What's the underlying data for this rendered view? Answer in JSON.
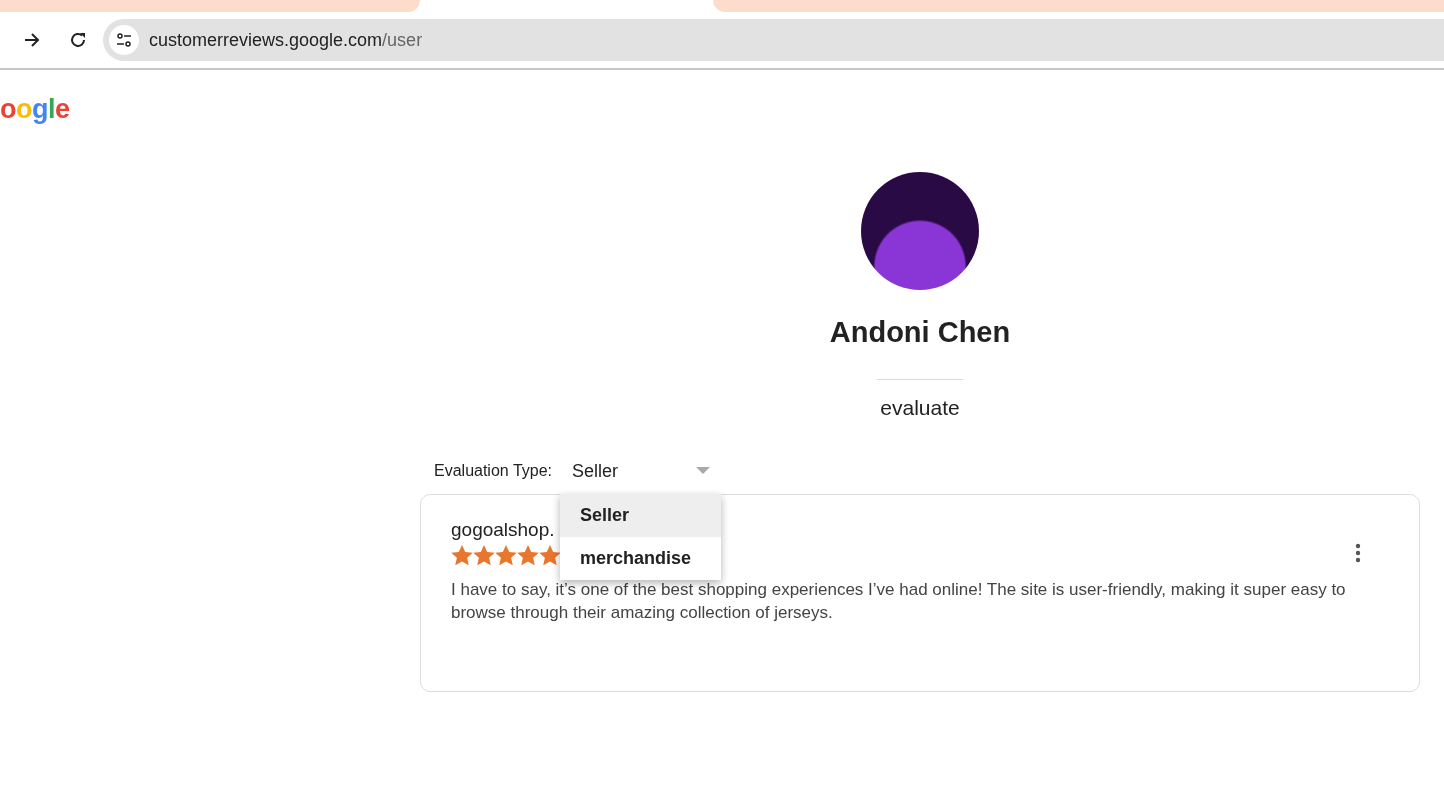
{
  "browser": {
    "url_host": "customerreviews.google.com",
    "url_path": "/user"
  },
  "logo": {
    "text": "oogle"
  },
  "profile": {
    "name": "Andoni Chen",
    "section": "evaluate"
  },
  "filter": {
    "label": "Evaluation Type:",
    "value": "Seller",
    "expanded": true,
    "options": [
      {
        "label": "Seller",
        "selected": true
      },
      {
        "label": "merchandise",
        "selected": false
      }
    ]
  },
  "reviews": [
    {
      "merchant": "gogoalshop.",
      "stars": 5,
      "text": "I have to say, it’s one of the best shopping experiences I’ve had online! The site is user-friendly, making it super easy to browse through their amazing collection of jerseys."
    }
  ]
}
